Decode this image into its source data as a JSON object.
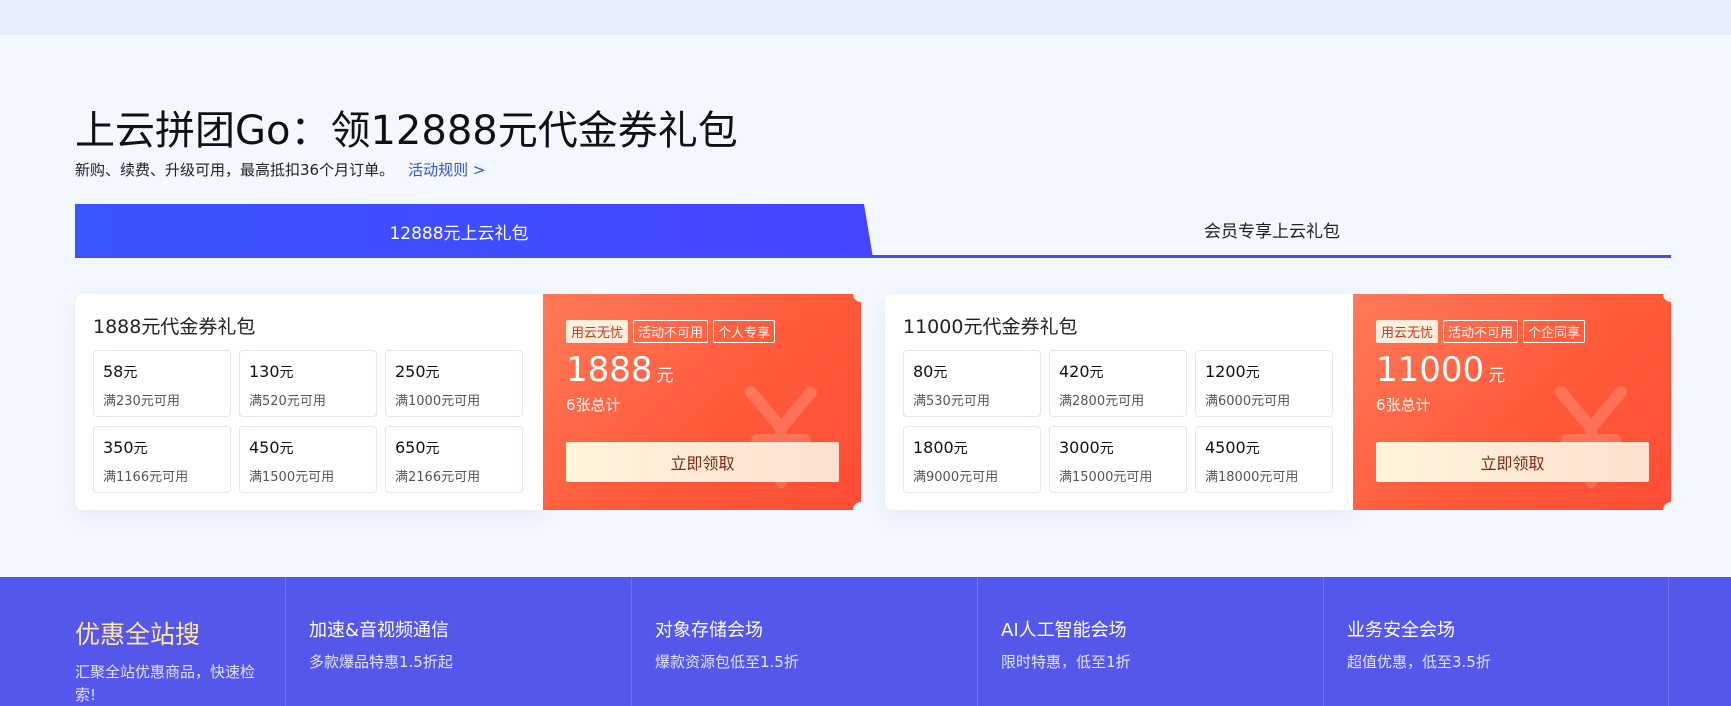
{
  "header": {
    "title": "上云拼团Go：领12888元代金券礼包",
    "subtitle": "新购、续费、升级可用，最高抵扣36个月订单。",
    "rules_link": "活动规则 >"
  },
  "tabs": [
    {
      "label": "12888元上云礼包",
      "active": true
    },
    {
      "label": "会员专享上云礼包",
      "active": false
    }
  ],
  "packages": [
    {
      "name": "1888元代金券礼包",
      "coupons": [
        {
          "amount": "58",
          "unit": "元",
          "condition": "满230元可用"
        },
        {
          "amount": "130",
          "unit": "元",
          "condition": "满520元可用"
        },
        {
          "amount": "250",
          "unit": "元",
          "condition": "满1000元可用"
        },
        {
          "amount": "350",
          "unit": "元",
          "condition": "满1166元可用"
        },
        {
          "amount": "450",
          "unit": "元",
          "condition": "满1500元可用"
        },
        {
          "amount": "650",
          "unit": "元",
          "condition": "满2166元可用"
        }
      ],
      "badges": [
        "用云无忧",
        "活动不可用",
        "个人专享"
      ],
      "total": "1888",
      "total_unit": "元",
      "count_text": "6张总计",
      "button": "立即领取"
    },
    {
      "name": "11000元代金券礼包",
      "coupons": [
        {
          "amount": "80",
          "unit": "元",
          "condition": "满530元可用"
        },
        {
          "amount": "420",
          "unit": "元",
          "condition": "满2800元可用"
        },
        {
          "amount": "1200",
          "unit": "元",
          "condition": "满6000元可用"
        },
        {
          "amount": "1800",
          "unit": "元",
          "condition": "满9000元可用"
        },
        {
          "amount": "3000",
          "unit": "元",
          "condition": "满15000元可用"
        },
        {
          "amount": "4500",
          "unit": "元",
          "condition": "满18000元可用"
        }
      ],
      "badges": [
        "用云无忧",
        "活动不可用",
        "个企同享"
      ],
      "total": "11000",
      "total_unit": "元",
      "count_text": "6张总计",
      "button": "立即领取"
    }
  ],
  "promo": {
    "title": "优惠全站搜",
    "desc": "汇聚全站优惠商品，快速检索!",
    "items": [
      {
        "title": "加速&音视频通信",
        "desc": "多款爆品特惠1.5折起"
      },
      {
        "title": "对象存储会场",
        "desc": "爆款资源包低至1.5折"
      },
      {
        "title": "AI人工智能会场",
        "desc": "限时特惠，低至1折"
      },
      {
        "title": "业务安全会场",
        "desc": "超值优惠，低至3.5折"
      }
    ]
  },
  "colors": {
    "accent_blue": "#3a54ff",
    "coupon_orange": "#ff5a3a",
    "band_blue": "#5457ea",
    "promo_gold": "#ffe7a8"
  }
}
